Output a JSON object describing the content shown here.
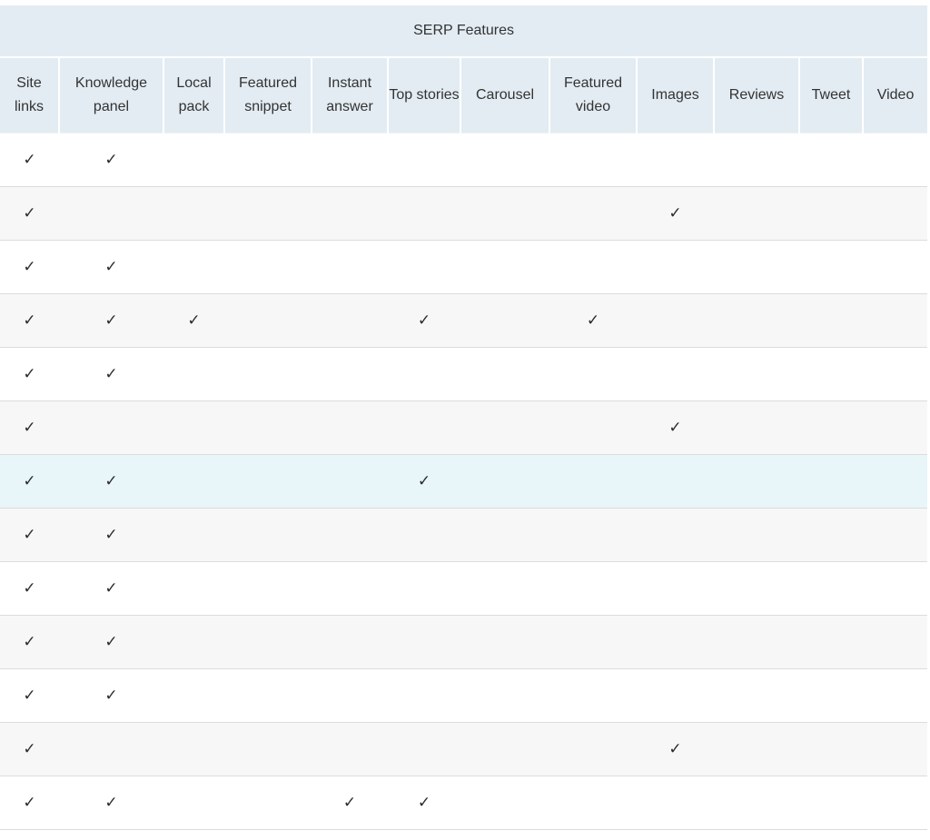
{
  "table": {
    "group_header": "SERP Features",
    "columns": [
      "Site links",
      "Knowledge panel",
      "Local pack",
      "Featured snippet",
      "Instant answer",
      "Top stories",
      "Carousel",
      "Featured video",
      "Images",
      "Reviews",
      "Tweet",
      "Video"
    ],
    "check_glyph": "✓",
    "highlighted_row": 6,
    "rows": [
      [
        true,
        true,
        false,
        false,
        false,
        false,
        false,
        false,
        false,
        false,
        false,
        false
      ],
      [
        true,
        false,
        false,
        false,
        false,
        false,
        false,
        false,
        true,
        false,
        false,
        false
      ],
      [
        true,
        true,
        false,
        false,
        false,
        false,
        false,
        false,
        false,
        false,
        false,
        false
      ],
      [
        true,
        true,
        true,
        false,
        false,
        true,
        false,
        true,
        false,
        false,
        false,
        false
      ],
      [
        true,
        true,
        false,
        false,
        false,
        false,
        false,
        false,
        false,
        false,
        false,
        false
      ],
      [
        true,
        false,
        false,
        false,
        false,
        false,
        false,
        false,
        true,
        false,
        false,
        false
      ],
      [
        true,
        true,
        false,
        false,
        false,
        true,
        false,
        false,
        false,
        false,
        false,
        false
      ],
      [
        true,
        true,
        false,
        false,
        false,
        false,
        false,
        false,
        false,
        false,
        false,
        false
      ],
      [
        true,
        true,
        false,
        false,
        false,
        false,
        false,
        false,
        false,
        false,
        false,
        false
      ],
      [
        true,
        true,
        false,
        false,
        false,
        false,
        false,
        false,
        false,
        false,
        false,
        false
      ],
      [
        true,
        true,
        false,
        false,
        false,
        false,
        false,
        false,
        false,
        false,
        false,
        false
      ],
      [
        true,
        false,
        false,
        false,
        false,
        false,
        false,
        false,
        true,
        false,
        false,
        false
      ],
      [
        true,
        true,
        false,
        false,
        true,
        true,
        false,
        false,
        false,
        false,
        false,
        false
      ]
    ]
  },
  "colors": {
    "header_bg": "#e3ecf3",
    "row_alt_bg": "#f7f7f7",
    "row_highlight_bg": "#e8f6fa",
    "border": "#dcdcdc",
    "text": "#333333"
  }
}
